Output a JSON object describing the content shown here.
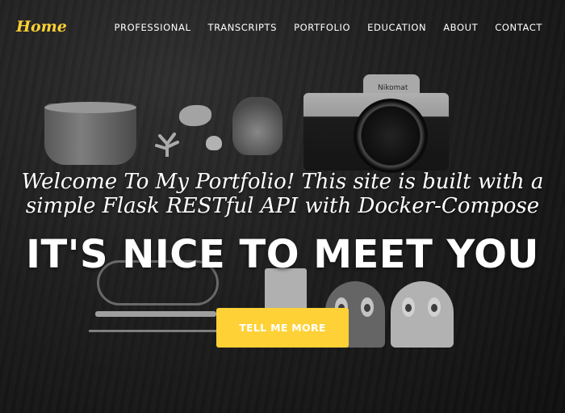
{
  "navbar": {
    "brand": "Home",
    "links": [
      "PROFESSIONAL",
      "TRANSCRIPTS",
      "PORTFOLIO",
      "EDUCATION",
      "ABOUT",
      "CONTACT"
    ]
  },
  "hero": {
    "lead": "Welcome To My Portfolio! This site is built with a simple Flask RESTful API with Docker-Compose",
    "heading": "IT'S NICE TO MEET YOU",
    "cta_label": "TELL ME MORE",
    "camera_label": "Nikomat"
  },
  "colors": {
    "accent": "#fed136",
    "text": "#ffffff",
    "background": "#1c1c1c"
  }
}
